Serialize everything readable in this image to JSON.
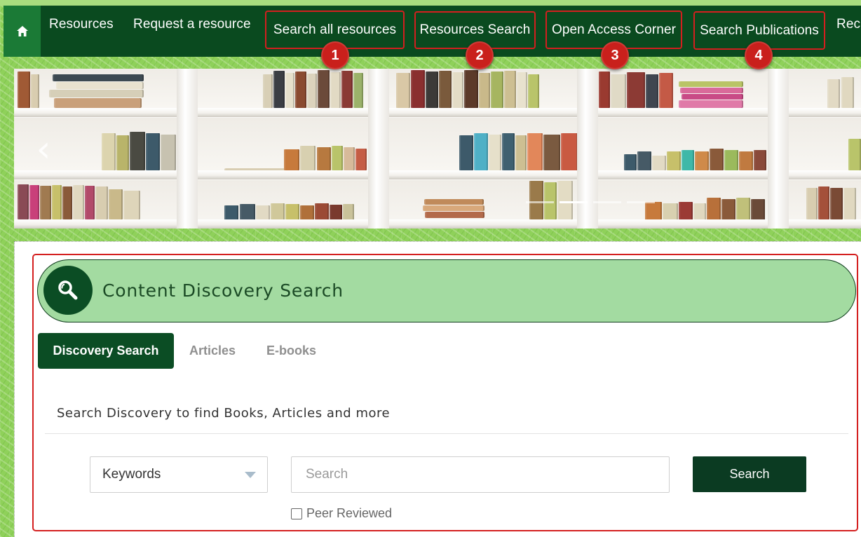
{
  "nav": {
    "home_icon": "home-icon",
    "items": [
      {
        "label": "Resources"
      },
      {
        "label": "Request a resource"
      },
      {
        "label": "Search all resources",
        "badge": "1"
      },
      {
        "label": "Resources Search",
        "badge": "2"
      },
      {
        "label": "Open Access Corner",
        "badge": "3"
      },
      {
        "label": "Search Publications",
        "badge": "4"
      },
      {
        "label": "Rec"
      }
    ]
  },
  "banner": {
    "prev_icon": "chevron-left-icon",
    "prev_glyph": "‹",
    "slides_count": 4,
    "active_slide": 2
  },
  "discovery": {
    "title": "Content Discovery Search",
    "icon": "search-magnifier-icon",
    "tabs": [
      {
        "label": "Discovery Search",
        "active": true
      },
      {
        "label": "Articles",
        "active": false
      },
      {
        "label": "E-books",
        "active": false
      }
    ],
    "intro": "Search Discovery to find Books, Articles and more",
    "select_value": "Keywords",
    "search_placeholder": "Search",
    "search_button": "Search",
    "peer_reviewed_label": "Peer Reviewed",
    "peer_reviewed_checked": false
  },
  "colors": {
    "nav_bg": "#0a4a1f",
    "accent": "#0b4d24",
    "header_bg": "#a3dba1",
    "highlight": "#d41f1f"
  }
}
